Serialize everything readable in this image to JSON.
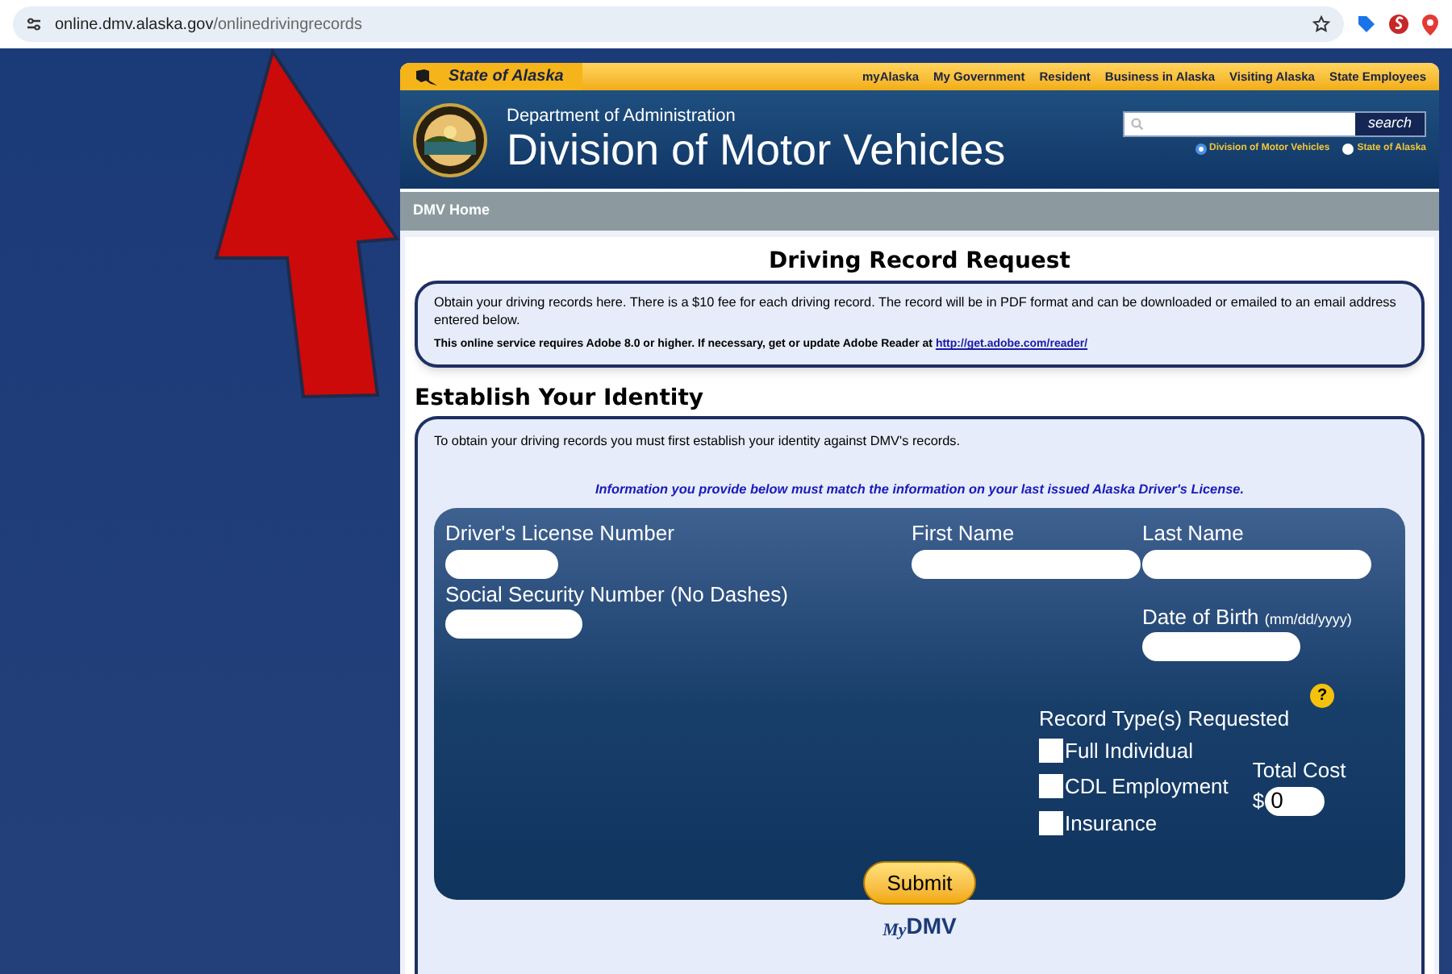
{
  "browser": {
    "url_host": "online.dmv.alaska.gov",
    "url_path": "/onlinedrivingrecords"
  },
  "state_bar": {
    "brand": "State of Alaska",
    "links": [
      "myAlaska",
      "My Government",
      "Resident",
      "Business in Alaska",
      "Visiting Alaska",
      "State Employees"
    ]
  },
  "header": {
    "department": "Department of Administration",
    "division": "Division of Motor Vehicles",
    "search_button": "search",
    "scopes": [
      {
        "label": "Division of Motor Vehicles",
        "selected": true
      },
      {
        "label": "State of Alaska",
        "selected": false
      }
    ]
  },
  "nav": {
    "items": [
      "DMV Home"
    ]
  },
  "title": "Driving Record Request",
  "info": {
    "text": "Obtain your driving records here. There is a $10 fee for each driving record. The record will be in PDF format and can be downloaded or emailed to an email address entered below.",
    "adobe_note": "This online service requires Adobe 8.0 or higher. If necessary, get or update Adobe Reader at",
    "adobe_link": "http://get.adobe.com/reader/"
  },
  "identity": {
    "heading": "Establish Your Identity",
    "intro": "To obtain your driving records you must first establish your identity against DMV's records.",
    "notice": "Information you provide below must match the information on your last issued Alaska Driver's License.",
    "fields": {
      "license": "Driver's License Number",
      "ssn": "Social Security Number (No Dashes)",
      "first_name": "First Name",
      "last_name": "Last Name",
      "dob": "Date of Birth",
      "dob_hint": "(mm/dd/yyyy)"
    },
    "record_types_label": "Record Type(s) Requested",
    "help": "?",
    "record_types": [
      {
        "label": "Full Individual",
        "checked": false
      },
      {
        "label": "CDL Employment",
        "checked": false
      },
      {
        "label": "Insurance",
        "checked": false
      }
    ],
    "total_label": "Total Cost",
    "currency": "$",
    "total_value": "0",
    "submit": "Submit"
  },
  "footer_logo": {
    "my": "My",
    "dmv": "DMV"
  }
}
